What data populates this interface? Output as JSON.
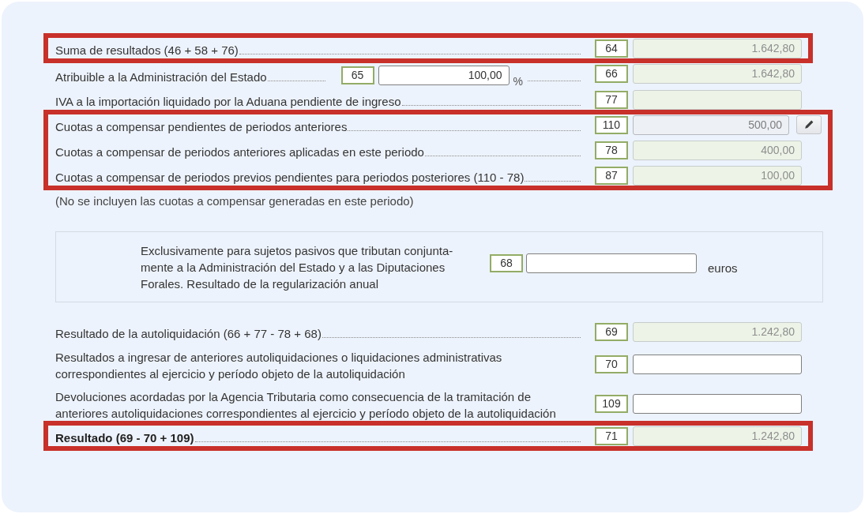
{
  "sections": [
    {
      "kind": "rows",
      "highlighted": true,
      "rows": [
        {
          "label": "Suma de resultados (46 + 58 + 76)",
          "bold": false,
          "code": "64",
          "field": {
            "kind": "computed",
            "value": "1.642,80"
          }
        }
      ]
    },
    {
      "kind": "rows",
      "highlighted": false,
      "rows": [
        {
          "label": "Atribuible a la Administración del Estado",
          "bold": false,
          "share": {
            "code": "65",
            "field": {
              "kind": "input",
              "value": "100,00"
            },
            "unit": "%"
          },
          "code": "66",
          "field": {
            "kind": "computed",
            "value": "1.642,80"
          }
        },
        {
          "label": "IVA a la importación liquidado por la Aduana pendiente de ingreso",
          "bold": false,
          "code": "77",
          "field": {
            "kind": "computed"
          }
        }
      ]
    },
    {
      "kind": "rows",
      "highlighted": true,
      "rows": [
        {
          "label": "Cuotas a compensar pendientes de periodos anteriores",
          "bold": false,
          "code": "110",
          "field": {
            "kind": "locked",
            "value": "500,00"
          },
          "edit_button": true
        },
        {
          "label": "Cuotas a compensar de periodos anteriores aplicadas en este periodo",
          "bold": false,
          "code": "78",
          "field": {
            "kind": "computed",
            "value": "400,00"
          }
        },
        {
          "label": "Cuotas a compensar de periodos previos pendientes para periodos posteriores (110 - 78)",
          "bold": false,
          "code": "87",
          "field": {
            "kind": "computed",
            "value": "100,00"
          }
        }
      ]
    },
    {
      "kind": "note",
      "text": "(No se incluyen las cuotas a compensar generadas en este periodo)"
    },
    {
      "kind": "panel",
      "text": "Exclusivamente para sujetos pasivos que tributan conjunta-mente a la Administración del Estado y a las Diputaciones Forales. Resultado de la regularización anual",
      "code": "68",
      "field": {
        "kind": "input"
      },
      "unit": "euros"
    },
    {
      "kind": "rows",
      "highlighted": false,
      "rows": [
        {
          "label": "Resultado de la autoliquidación (66 + 77 - 78 + 68)",
          "bold": false,
          "code": "69",
          "field": {
            "kind": "computed",
            "value": "1.242,80"
          }
        },
        {
          "label": "Resultados a ingresar de anteriores autoliquidaciones o liquidaciones administrativas correspondientes al ejercicio y período objeto de la autoliquidación",
          "bold": false,
          "code": "70",
          "field": {
            "kind": "input"
          }
        },
        {
          "label": "Devoluciones acordadas por la Agencia Tributaria como consecuencia de la tramitación de anteriores autoliquidaciones correspondientes al ejercicio y período objeto de la autoliquidación",
          "bold": false,
          "code": "109",
          "field": {
            "kind": "input"
          }
        }
      ]
    },
    {
      "kind": "rows",
      "highlighted": true,
      "rows": [
        {
          "label": "Resultado (69 - 70 + 109)",
          "bold": true,
          "code": "71",
          "field": {
            "kind": "computed",
            "value": "1.242,80"
          }
        }
      ]
    }
  ]
}
